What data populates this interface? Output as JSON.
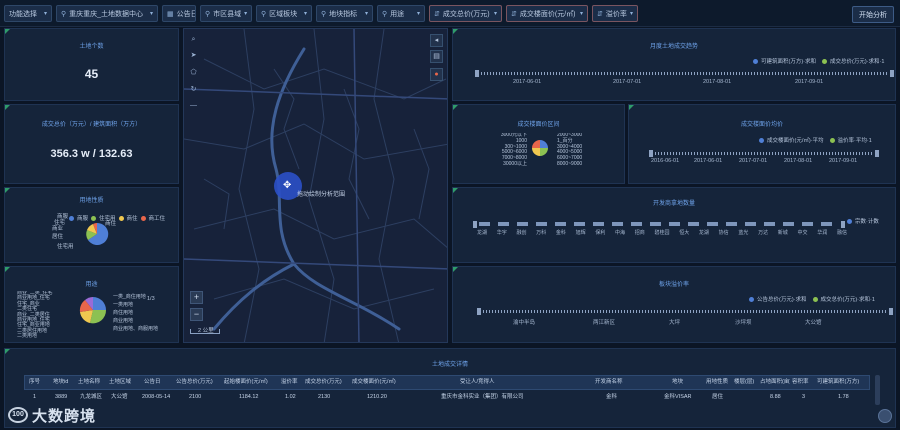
{
  "toolbar": {
    "buttons": [
      {
        "label": "功能选择",
        "icon": ""
      },
      {
        "label": "重庆重庆_土地数据中心",
        "icon": "⚲"
      },
      {
        "label": "公告日",
        "icon": "▦"
      },
      {
        "label": "市区县域",
        "icon": "⚲"
      },
      {
        "label": "区域板块",
        "icon": "⚲"
      },
      {
        "label": "地块指标",
        "icon": "⚲"
      },
      {
        "label": "用途",
        "icon": "⚲"
      },
      {
        "label": "成交总价(万元)",
        "icon": "⇵"
      },
      {
        "label": "成交楼面价(元/㎡)",
        "icon": "⇵"
      },
      {
        "label": "溢价率",
        "icon": "⇵"
      }
    ],
    "analyze_label": "开始分析"
  },
  "kpi": {
    "land_count_title": "土地个数",
    "land_count_value": "45",
    "amount_title": "成交总价（万元）/ 建筑面积（万方）",
    "amount_value": "356.3 w / 132.63"
  },
  "pie_usage": {
    "title": "用地性质",
    "legend": [
      {
        "label": "商服",
        "color": "#4f7fd6"
      },
      {
        "label": "住宅用",
        "color": "#8cc152"
      },
      {
        "label": "商住",
        "color": "#f0c850"
      },
      {
        "label": "商工住",
        "color": "#e8664b"
      }
    ],
    "slice_labels": [
      "商服",
      "住宅",
      "商业",
      "商住",
      "居住",
      "住宅用"
    ]
  },
  "pie_purpose": {
    "title": "用途",
    "labels_left": [
      "商业_二类_住宅",
      "商业用地_住宅",
      "住宅_商业",
      "二类住宅",
      "商业_二类居住",
      "商业用地_住宅",
      "住宅_商业用地",
      "二类居住用地",
      "二类用地"
    ],
    "labels_right": [
      "一类_商住用地",
      "一类用地",
      "商住用地",
      "商业用地",
      "商业用地、商服用地"
    ],
    "page": "1/3"
  },
  "map": {
    "drag_hint": "拖动绘制分析范围",
    "scale_label": "2 公里",
    "tools": [
      "⌕",
      "➤",
      "⬠",
      "↻",
      "—"
    ],
    "zoom_in": "+",
    "zoom_out": "−",
    "right_tools": [
      "◂",
      "▤",
      "●"
    ]
  },
  "trend": {
    "title": "月度土地成交趋势",
    "legend": [
      "可建筑面积(万方)·求和",
      "成交总价(万元)·求和·1"
    ],
    "ticks": [
      "2017-06-01",
      "2017-07-01",
      "2017-08-01",
      "2017-09-01"
    ]
  },
  "price_dist": {
    "title": "成交楼面价区间",
    "labels": [
      "3000元以下",
      "2000~3000",
      "1000",
      "3000~4000",
      "300~1000",
      "4000~5000",
      "5000~6000",
      "6000~7000",
      "7000~8000",
      "30000以上",
      "8000~9000",
      "1_百分"
    ]
  },
  "avg_price": {
    "title": "成交楼面价均价",
    "legend": [
      "成交楼面价(元/㎡)·平均",
      "溢价率·平均·1"
    ],
    "ticks": [
      "2016-06-01",
      "2017-06-01",
      "2017-07-01",
      "2017-08-01",
      "2017-09-01"
    ]
  },
  "developer": {
    "title": "开发商拿地数量",
    "legend": "宗数·计数",
    "ticks": [
      "龙湖",
      "华宇",
      "融创",
      "万科",
      "金科",
      "旭辉",
      "保利",
      "中海",
      "招商",
      "碧桂园",
      "恒大",
      "龙湖",
      "协信",
      "蓝光",
      "万达",
      "新城",
      "中交",
      "华润",
      "融信"
    ]
  },
  "premium": {
    "title": "板块溢价率",
    "legend": [
      "公告总价(万元)·求和",
      "成交总价(万元)·求和·1"
    ],
    "ticks": [
      "渝中半岛",
      "两江新区",
      "大坪",
      "沙坪坝",
      "大公馆"
    ]
  },
  "table": {
    "title": "土地成交详情",
    "headers": [
      "序号",
      "地块id",
      "土地名称",
      "土地区域",
      "公告日",
      "公告总价(万元)",
      "起始楼面价(元/㎡)",
      "溢价率",
      "成交总价(万元)",
      "成交楼面价(元/㎡)",
      "受让人/竞得人",
      "开发商名称",
      "地块",
      "用地性质",
      "楼层(层)",
      "占地面积(亩)",
      "容积率",
      "可建筑面积(万方)"
    ],
    "rows": [
      [
        "1",
        "3889",
        "九龙城区",
        "大公馆",
        "2008-05-14",
        "2100",
        "1184.12",
        "1.02",
        "2130",
        "1210.20",
        "重庆市金科实业（集团）有限公司",
        "金科",
        "金科VISAR",
        "居住",
        "",
        "8.88",
        "3",
        "1.78"
      ]
    ]
  },
  "logo": {
    "mark": "100",
    "name": "大数跨境"
  },
  "colors": {
    "accent": "#6fa3ea",
    "panel": "#15243a",
    "bg": "#0b1525",
    "green_corner": "#2f9c6b"
  }
}
